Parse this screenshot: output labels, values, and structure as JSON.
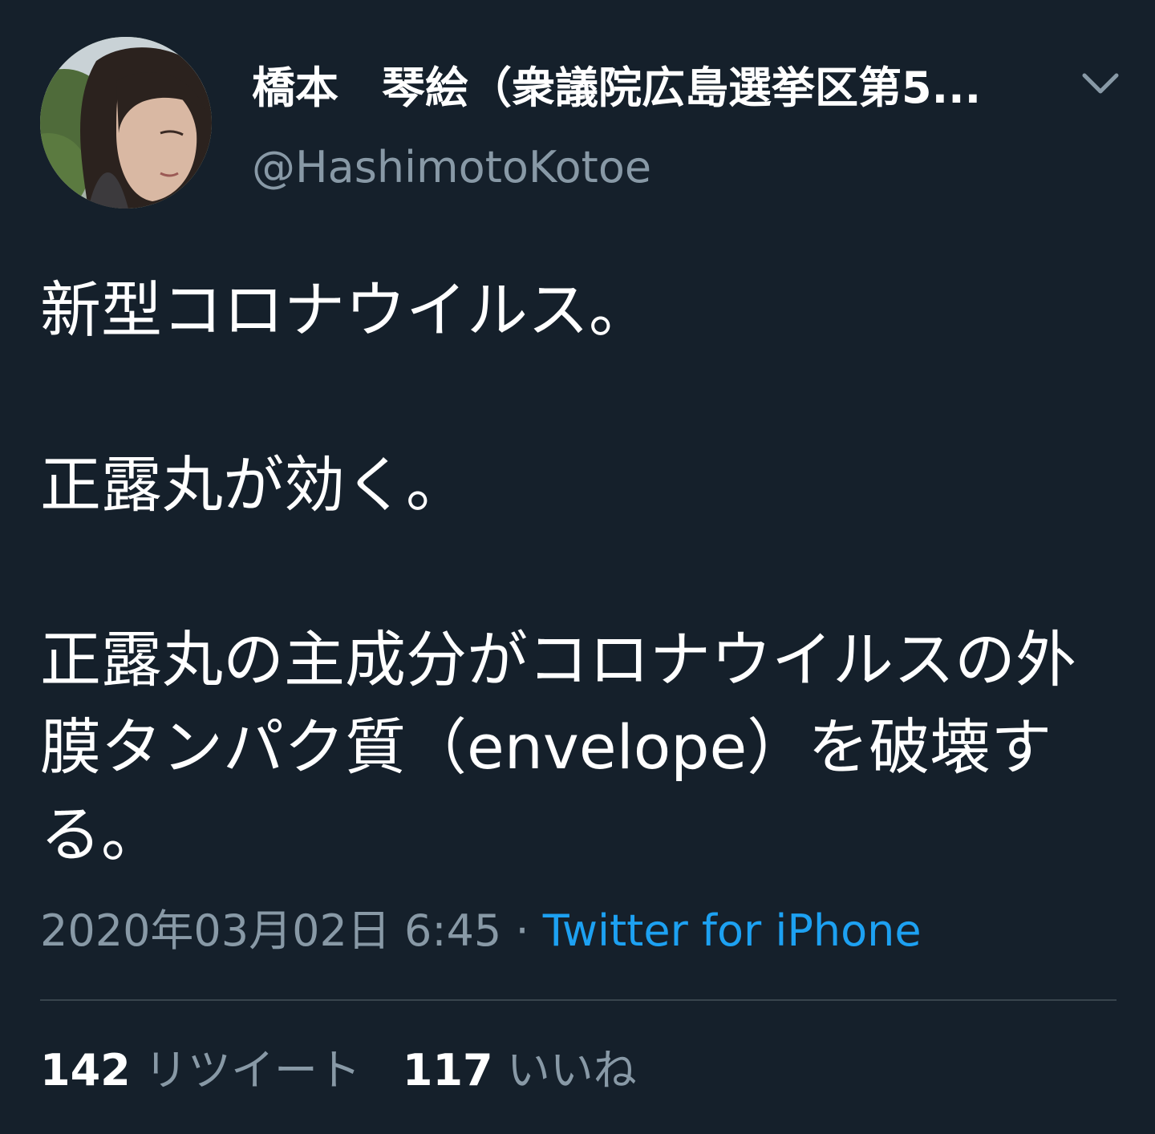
{
  "author": {
    "display_name": "橋本　琴絵（衆議院広島選挙区第5...",
    "handle": "@HashimotoKotoe",
    "avatar_icon": "profile-photo"
  },
  "menu": {
    "icon": "chevron-down-icon"
  },
  "tweet": {
    "paragraphs": [
      "新型コロナウイルス。",
      "正露丸が効く。",
      "正露丸の主成分がコロナウイルスの外膜タンパク質（envelope）を破壊する。"
    ],
    "timestamp": "2020年03月02日 6:45",
    "separator": " · ",
    "source": "Twitter for iPhone"
  },
  "stats": {
    "retweets_count": "142",
    "retweets_label": "リツイート",
    "likes_count": "117",
    "likes_label": "いいね"
  },
  "colors": {
    "background": "#15202b",
    "text_primary": "#ffffff",
    "text_secondary": "#8899a6",
    "link": "#1da1f2",
    "divider": "#38444d"
  }
}
